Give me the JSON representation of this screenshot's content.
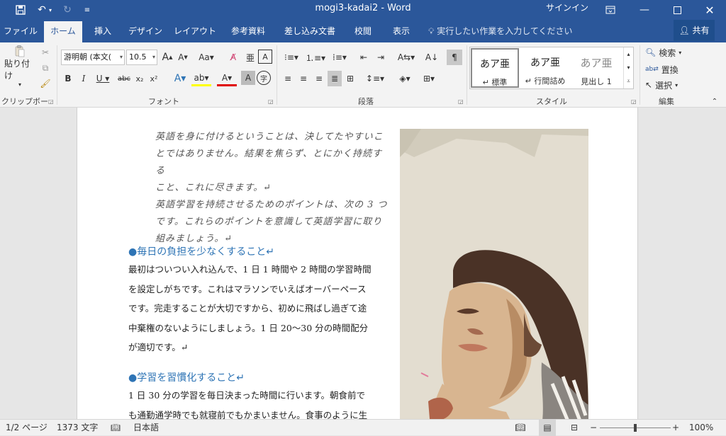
{
  "titlebar": {
    "title": "mogi3-kadai2 - Word",
    "signin": "サインイン"
  },
  "tabs": [
    {
      "label": "ファイル"
    },
    {
      "label": "ホーム"
    },
    {
      "label": "挿入"
    },
    {
      "label": "デザイン"
    },
    {
      "label": "レイアウト"
    },
    {
      "label": "参考資料"
    },
    {
      "label": "差し込み文書"
    },
    {
      "label": "校閲"
    },
    {
      "label": "表示"
    }
  ],
  "tell_me": "実行したい作業を入力してください",
  "share": "共有",
  "ribbon": {
    "clipboard": {
      "paste": "貼り付け",
      "label": "クリップボード"
    },
    "font": {
      "name": "游明朝 (本文(",
      "size": "10.5",
      "label": "フォント"
    },
    "paragraph": {
      "label": "段落"
    },
    "styles": {
      "label": "スタイル",
      "items": [
        {
          "sample": "あア亜",
          "name": "↵ 標準"
        },
        {
          "sample": "あア亜",
          "name": "↵ 行間詰め"
        },
        {
          "sample": "あア亜",
          "name": "見出し 1"
        }
      ]
    },
    "editing": {
      "find": "検索",
      "replace": "置換",
      "select": "選択",
      "label": "編集"
    }
  },
  "document": {
    "italic_lines": [
      "英語を身に付けるということは、決してたやすいこ",
      "とではありません。結果を焦らず、とにかく持続する",
      "こと、これに尽きます。↵",
      "英語学習を持続させるためのポイントは、次の 3 つ",
      "です。これらのポイントを意識して英語学習に取り",
      "組みましょう。↵"
    ],
    "heading1": "●毎日の負担を少なくすること↵",
    "para1_lines": [
      "最初はついつい入れ込んで、1 日 1 時間や 2 時間の学習時間",
      "を設定しがちです。これはマラソンでいえばオーバーペース",
      "です。完走することが大切ですから、初めに飛ばし過ぎて途",
      "中棄権のないようにしましょう。1 日 20～30 分の時間配分",
      "が適切です。↵"
    ],
    "heading2": "●学習を習慣化すること↵",
    "para2_lines": [
      "1 日 30 分の学習を毎日決まった時間に行います。朝食前で",
      "も通勤通学時でも就寝前でもかまいません。食事のように生"
    ]
  },
  "status": {
    "page": "1/2 ページ",
    "words": "1373 文字",
    "language": "日本語",
    "zoom": "100%",
    "zoom_value": 100
  }
}
